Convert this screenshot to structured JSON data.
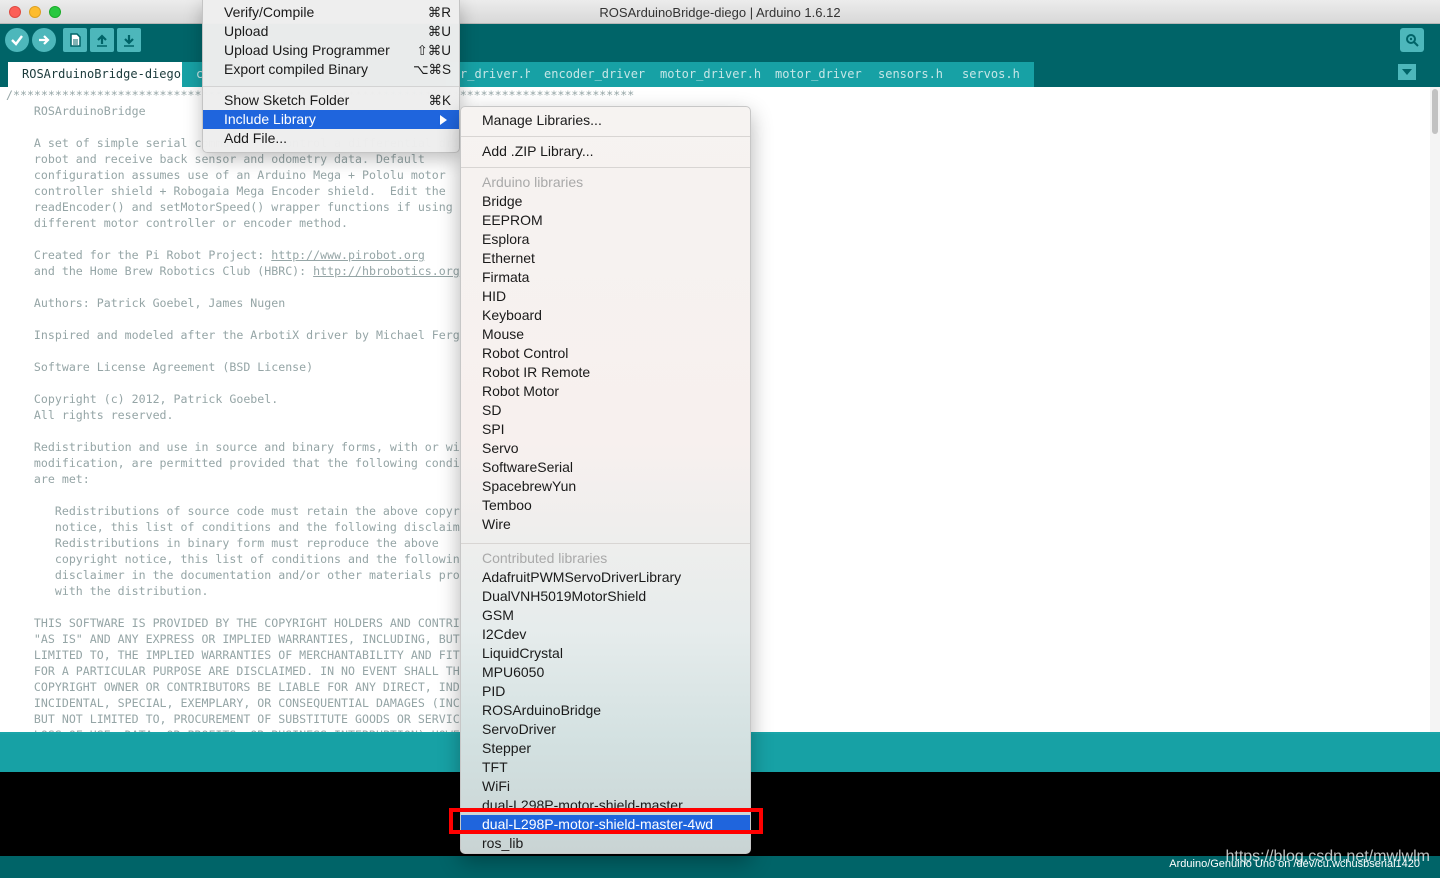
{
  "window": {
    "title": "ROSArduinoBridge-diego | Arduino 1.6.12"
  },
  "toolbar": {
    "verify": "check-icon",
    "upload": "arrow-right-icon",
    "new": "new-file-icon",
    "open": "open-arrow-up-icon",
    "save": "save-arrow-down-icon",
    "serial_monitor": "magnifier-icon"
  },
  "tabs": [
    "ROSArduinoBridge-diego",
    "c",
    "r_driver.h",
    "encoder_driver",
    "motor_driver.h",
    "motor_driver",
    "sensors.h",
    "servos.h"
  ],
  "editor": {
    "lines": [
      "/*****************************************************************************************",
      "    ROSArduinoBridge",
      "",
      "    A set of simple serial commands to control a differential drive",
      "    robot and receive back sensor and odometry data. Default",
      "    configuration assumes use of an Arduino Mega + Pololu motor",
      "    controller shield + Robogaia Mega Encoder shield.  Edit the",
      "    readEncoder() and setMotorSpeed() wrapper functions if using",
      "    different motor controller or encoder method.",
      "",
      "    Created for the Pi Robot Project: ",
      "    and the Home Brew Robotics Club (HBRC): ",
      "",
      "    Authors: Patrick Goebel, James Nugen",
      "",
      "    Inspired and modeled after the ArbotiX driver by Michael Ferguson",
      "",
      "    Software License Agreement (BSD License)",
      "",
      "    Copyright (c) 2012, Patrick Goebel.",
      "    All rights reserved.",
      "",
      "    Redistribution and use in source and binary forms, with or without",
      "    modification, are permitted provided that the following conditions",
      "    are met:",
      "",
      "       Redistributions of source code must retain the above copyright",
      "       notice, this list of conditions and the following disclaimer.",
      "       Redistributions in binary form must reproduce the above",
      "       copyright notice, this list of conditions and the following",
      "       disclaimer in the documentation and/or other materials provided",
      "       with the distribution.",
      "",
      "    THIS SOFTWARE IS PROVIDED BY THE COPYRIGHT HOLDERS AND CONTRIBUTORS",
      "    \"AS IS\" AND ANY EXPRESS OR IMPLIED WARRANTIES, INCLUDING, BUT NOT",
      "    LIMITED TO, THE IMPLIED WARRANTIES OF MERCHANTABILITY AND FITNESS",
      "    FOR A PARTICULAR PURPOSE ARE DISCLAIMED. IN NO EVENT SHALL THE",
      "    COPYRIGHT OWNER OR CONTRIBUTORS BE LIABLE FOR ANY DIRECT, INDIRECT,",
      "    INCIDENTAL, SPECIAL, EXEMPLARY, OR CONSEQUENTIAL DAMAGES (INCLUDING,",
      "    BUT NOT LIMITED TO, PROCUREMENT OF SUBSTITUTE GOODS OR SERVICES;",
      "    LOSS OF USE, DATA, OR PROFITS; OR BUSINESS INTERRUPTION) HOWEVER"
    ],
    "link1": "http://www.pirobot.org",
    "link2": "http://hbrobotics.org"
  },
  "sketch_menu": {
    "items": [
      {
        "label": "Verify/Compile",
        "shortcut": "⌘R"
      },
      {
        "label": "Upload",
        "shortcut": "⌘U"
      },
      {
        "label": "Upload Using Programmer",
        "shortcut": "⇧⌘U"
      },
      {
        "label": "Export compiled Binary",
        "shortcut": "⌥⌘S"
      },
      {
        "label": "Show Sketch Folder",
        "shortcut": "⌘K"
      },
      {
        "label": "Include Library",
        "shortcut": ""
      },
      {
        "label": "Add File...",
        "shortcut": ""
      }
    ]
  },
  "library_menu": {
    "manage": "Manage Libraries...",
    "add_zip": "Add .ZIP Library...",
    "arduino_header": "Arduino libraries",
    "arduino_libs": [
      "Bridge",
      "EEPROM",
      "Esplora",
      "Ethernet",
      "Firmata",
      "HID",
      "Keyboard",
      "Mouse",
      "Robot Control",
      "Robot IR Remote",
      "Robot Motor",
      "SD",
      "SPI",
      "Servo",
      "SoftwareSerial",
      "SpacebrewYun",
      "Temboo",
      "Wire"
    ],
    "contributed_header": "Contributed libraries",
    "contributed_libs": [
      "AdafruitPWMServoDriverLibrary",
      "DualVNH5019MotorShield",
      "GSM",
      "I2Cdev",
      "LiquidCrystal",
      "MPU6050",
      "PID",
      "ROSArduinoBridge",
      "ServoDriver",
      "Stepper",
      "TFT",
      "WiFi",
      "dual-L298P-motor-shield-master",
      "dual-L298P-motor-shield-master-4wd",
      "ros_lib"
    ],
    "selected": "dual-L298P-motor-shield-master-4wd"
  },
  "status": {
    "board_info": "Arduino/Genuino Uno on /dev/cu.wchusbserial1420",
    "watermark": "https://blog.csdn.net/mwlwlm"
  },
  "colors": {
    "toolbar": "#006468",
    "tab_inactive": "#17a1a5",
    "highlight": "#1f65dd",
    "annotation_box": "#ff0000"
  }
}
